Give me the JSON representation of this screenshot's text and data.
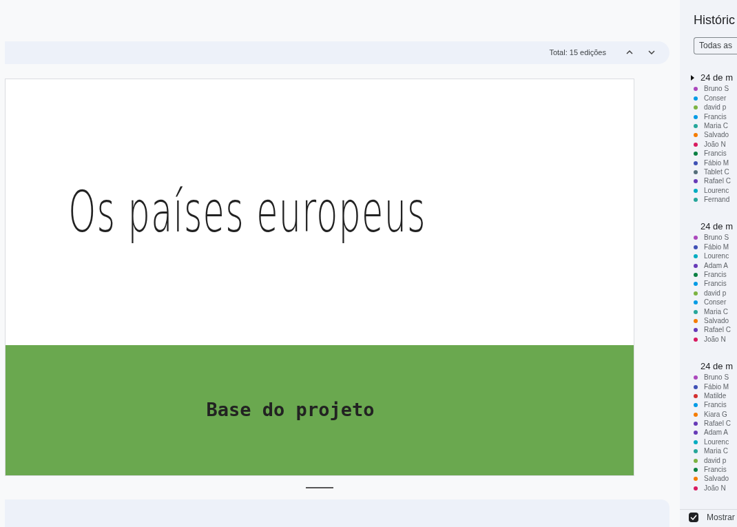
{
  "toolbar": {
    "total": "Total: 15 edições"
  },
  "slide": {
    "title": "Os países europeus",
    "subtitle": "Base do projeto"
  },
  "sidebar": {
    "title": "Históric",
    "filter": "Todas as",
    "groups": [
      {
        "heading": "24 de m",
        "toggle": true,
        "people": [
          {
            "name": "Bruno S",
            "color": "#ab47bc"
          },
          {
            "name": "Conser",
            "color": "#039be5"
          },
          {
            "name": "david p",
            "color": "#7cb342"
          },
          {
            "name": "Francis",
            "color": "#039be5"
          },
          {
            "name": "Maria C",
            "color": "#26a69a"
          },
          {
            "name": "Salvado",
            "color": "#f57c00"
          },
          {
            "name": "João N",
            "color": "#d81b60"
          },
          {
            "name": "Francis",
            "color": "#0b8043"
          },
          {
            "name": "Fábio M",
            "color": "#3f51b5"
          },
          {
            "name": "Tablet C",
            "color": "#546e7a"
          },
          {
            "name": "Rafael C",
            "color": "#673ab7"
          },
          {
            "name": "Lourenc",
            "color": "#00acc1"
          },
          {
            "name": "Fernand",
            "color": "#26a69a"
          }
        ]
      },
      {
        "heading": "24 de m",
        "toggle": false,
        "people": [
          {
            "name": "Bruno S",
            "color": "#ab47bc"
          },
          {
            "name": "Fábio M",
            "color": "#3f51b5"
          },
          {
            "name": "Lourenc",
            "color": "#00acc1"
          },
          {
            "name": "Adam A",
            "color": "#673ab7"
          },
          {
            "name": "Francis",
            "color": "#0b8043"
          },
          {
            "name": "Francis",
            "color": "#039be5"
          },
          {
            "name": "david p",
            "color": "#7cb342"
          },
          {
            "name": "Conser",
            "color": "#039be5"
          },
          {
            "name": "Maria C",
            "color": "#26a69a"
          },
          {
            "name": "Salvado",
            "color": "#f57c00"
          },
          {
            "name": "Rafael C",
            "color": "#673ab7"
          },
          {
            "name": "João N",
            "color": "#d81b60"
          }
        ]
      },
      {
        "heading": "24 de m",
        "toggle": false,
        "people": [
          {
            "name": "Bruno S",
            "color": "#ab47bc"
          },
          {
            "name": "Fábio M",
            "color": "#3f51b5"
          },
          {
            "name": "Matilde",
            "color": "#d32f2f"
          },
          {
            "name": "Francis",
            "color": "#039be5"
          },
          {
            "name": "Kiara G",
            "color": "#f57c00"
          },
          {
            "name": "Rafael C",
            "color": "#673ab7"
          },
          {
            "name": "Adam A",
            "color": "#673ab7"
          },
          {
            "name": "Lourenc",
            "color": "#00acc1"
          },
          {
            "name": "Maria C",
            "color": "#26a69a"
          },
          {
            "name": "david p",
            "color": "#7cb342"
          },
          {
            "name": "Francis",
            "color": "#0b8043"
          },
          {
            "name": "Salvado",
            "color": "#f57c00"
          },
          {
            "name": "João N",
            "color": "#d81b60"
          }
        ]
      }
    ]
  },
  "footer": {
    "label": "Mostrar",
    "checked": true
  }
}
